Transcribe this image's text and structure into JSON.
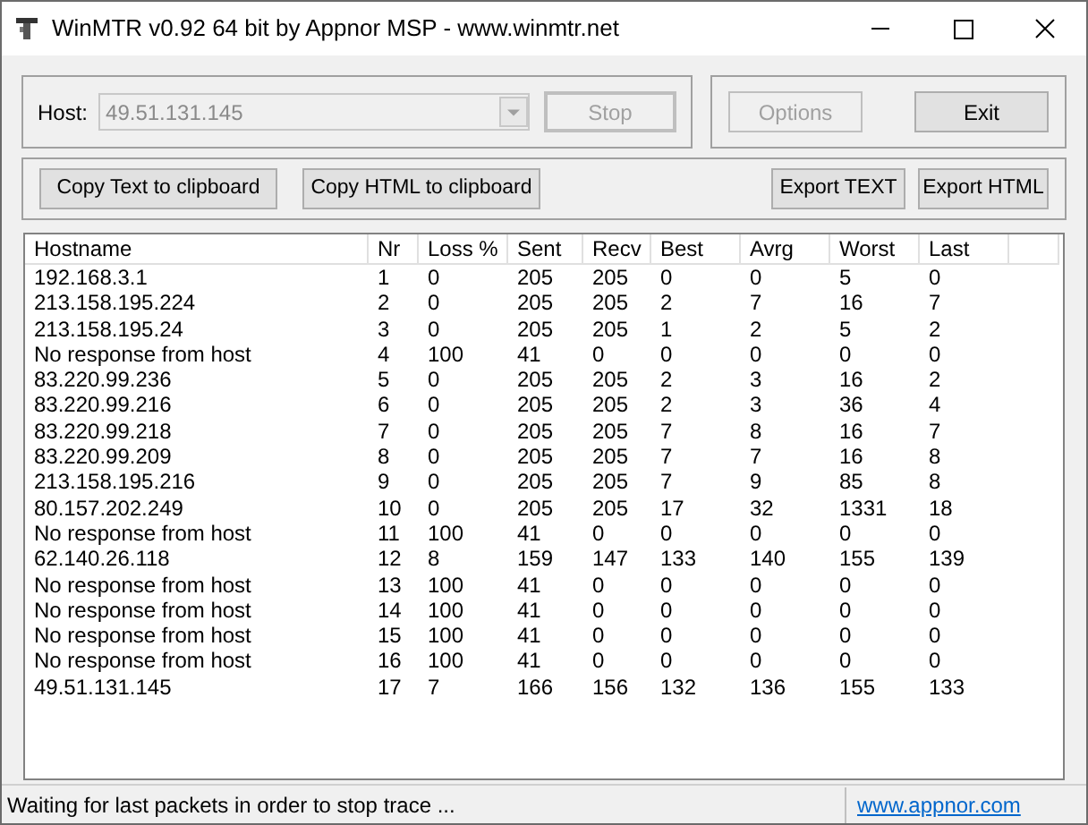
{
  "window": {
    "title": "WinMTR v0.92 64 bit by Appnor MSP - www.winmtr.net"
  },
  "host": {
    "label": "Host:",
    "value": "49.51.131.145",
    "disabled": true
  },
  "buttons_top": [
    {
      "label": "Stop",
      "disabled": true
    },
    {
      "label": "Options",
      "disabled": true
    },
    {
      "label": "Exit",
      "disabled": false
    }
  ],
  "buttons_export": [
    {
      "label": "Copy Text to clipboard"
    },
    {
      "label": "Copy HTML to clipboard"
    },
    {
      "label": "Export TEXT"
    },
    {
      "label": "Export HTML"
    }
  ],
  "table": {
    "columns": [
      "Hostname",
      "Nr",
      "Loss %",
      "Sent",
      "Recv",
      "Best",
      "Avrg",
      "Worst",
      "Last"
    ],
    "rows": [
      [
        "192.168.3.1",
        "1",
        "0",
        "205",
        "205",
        "0",
        "0",
        "5",
        "0"
      ],
      [
        "213.158.195.224",
        "2",
        "0",
        "205",
        "205",
        "2",
        "7",
        "16",
        "7"
      ],
      [
        "213.158.195.24",
        "3",
        "0",
        "205",
        "205",
        "1",
        "2",
        "5",
        "2"
      ],
      [
        "No response from host",
        "4",
        "100",
        "41",
        "0",
        "0",
        "0",
        "0",
        "0"
      ],
      [
        "83.220.99.236",
        "5",
        "0",
        "205",
        "205",
        "2",
        "3",
        "16",
        "2"
      ],
      [
        "83.220.99.216",
        "6",
        "0",
        "205",
        "205",
        "2",
        "3",
        "36",
        "4"
      ],
      [
        "83.220.99.218",
        "7",
        "0",
        "205",
        "205",
        "7",
        "8",
        "16",
        "7"
      ],
      [
        "83.220.99.209",
        "8",
        "0",
        "205",
        "205",
        "7",
        "7",
        "16",
        "8"
      ],
      [
        "213.158.195.216",
        "9",
        "0",
        "205",
        "205",
        "7",
        "9",
        "85",
        "8"
      ],
      [
        "80.157.202.249",
        "10",
        "0",
        "205",
        "205",
        "17",
        "32",
        "1331",
        "18"
      ],
      [
        "No response from host",
        "11",
        "100",
        "41",
        "0",
        "0",
        "0",
        "0",
        "0"
      ],
      [
        "62.140.26.118",
        "12",
        "8",
        "159",
        "147",
        "133",
        "140",
        "155",
        "139"
      ],
      [
        "No response from host",
        "13",
        "100",
        "41",
        "0",
        "0",
        "0",
        "0",
        "0"
      ],
      [
        "No response from host",
        "14",
        "100",
        "41",
        "0",
        "0",
        "0",
        "0",
        "0"
      ],
      [
        "No response from host",
        "15",
        "100",
        "41",
        "0",
        "0",
        "0",
        "0",
        "0"
      ],
      [
        "No response from host",
        "16",
        "100",
        "41",
        "0",
        "0",
        "0",
        "0",
        "0"
      ],
      [
        "49.51.131.145",
        "17",
        "7",
        "166",
        "156",
        "132",
        "136",
        "155",
        "133"
      ]
    ]
  },
  "status_bar": {
    "text": "Waiting for last packets in order to stop trace ...",
    "link": "www.appnor.com"
  }
}
